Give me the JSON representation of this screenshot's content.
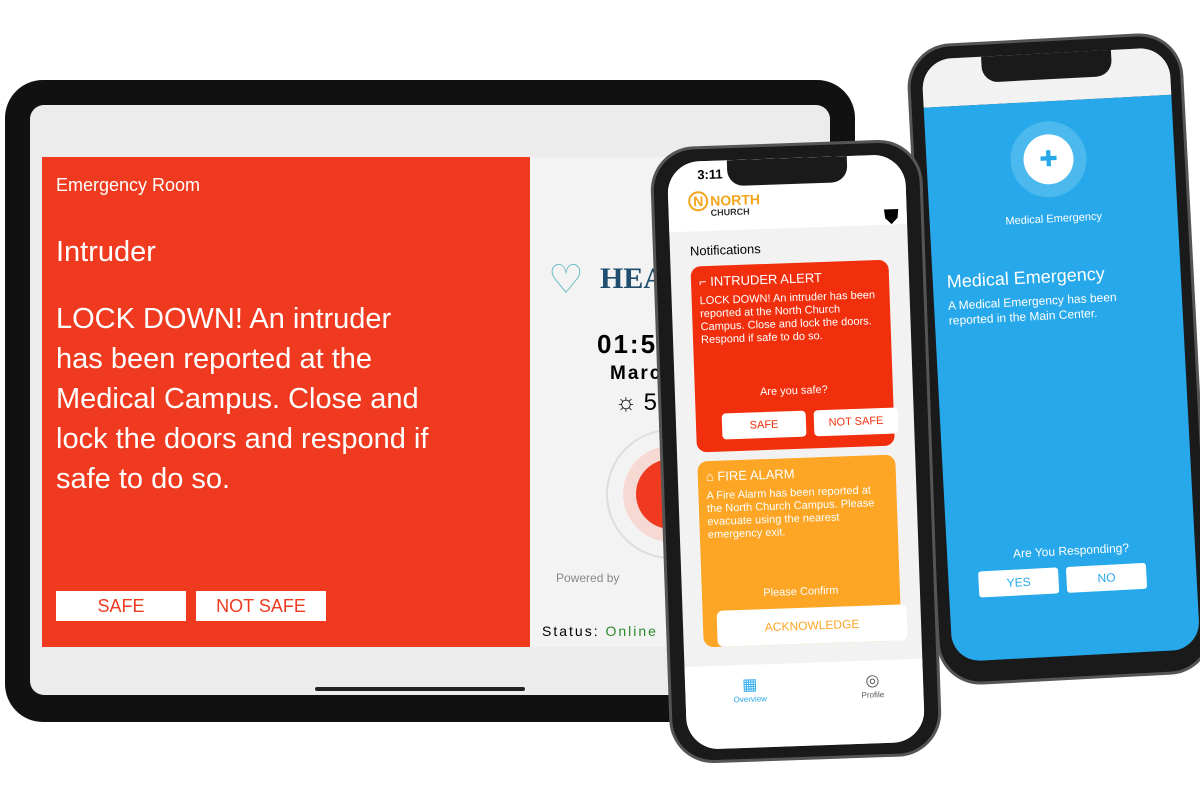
{
  "tablet": {
    "room": "Emergency Room",
    "alert_title": "Intruder",
    "message": "LOCK DOWN! An intruder has been reported at the Medical Campus. Close and lock the doors and respond if safe to do so.",
    "safe": "SAFE",
    "not_safe": "NOT SAFE",
    "brand": "HEA",
    "clock": "01:5",
    "date": "Marc",
    "weather": "5",
    "powered_by": "Powered by",
    "status_label": "Status:",
    "status_value": "Online"
  },
  "phone1": {
    "time": "3:11",
    "logo_north": "NORTH",
    "logo_church": "CHURCH",
    "logo_letter": "N",
    "notifications_title": "Notifications",
    "intruder": {
      "title": "INTRUDER ALERT",
      "message": "LOCK DOWN! An intruder has been reported at the North Church Campus. Close and lock the doors. Respond if safe to do so.",
      "question": "Are you safe?",
      "safe": "SAFE",
      "not_safe": "NOT SAFE"
    },
    "fire": {
      "title": "FIRE ALARM",
      "message": "A Fire Alarm has been reported at the North Church Campus. Please evacuate using the nearest emergency exit.",
      "question": "Please Confirm",
      "acknowledge": "ACKNOWLEDGE"
    },
    "tabs": [
      {
        "label": "Overview"
      },
      {
        "label": "Profile"
      }
    ]
  },
  "phone2": {
    "label": "Medical Emergency",
    "title": "Medical Emergency",
    "message": "A Medical Emergency has been reported in the Main Center.",
    "question": "Are You Responding?",
    "yes": "YES",
    "no": "NO"
  },
  "colors": {
    "tablet_red": "#ef3a1f",
    "intruder_red": "#f22f0c",
    "fire_orange": "#fda524",
    "medical_blue": "#27a8ea",
    "online_green": "#2a8a2a"
  }
}
